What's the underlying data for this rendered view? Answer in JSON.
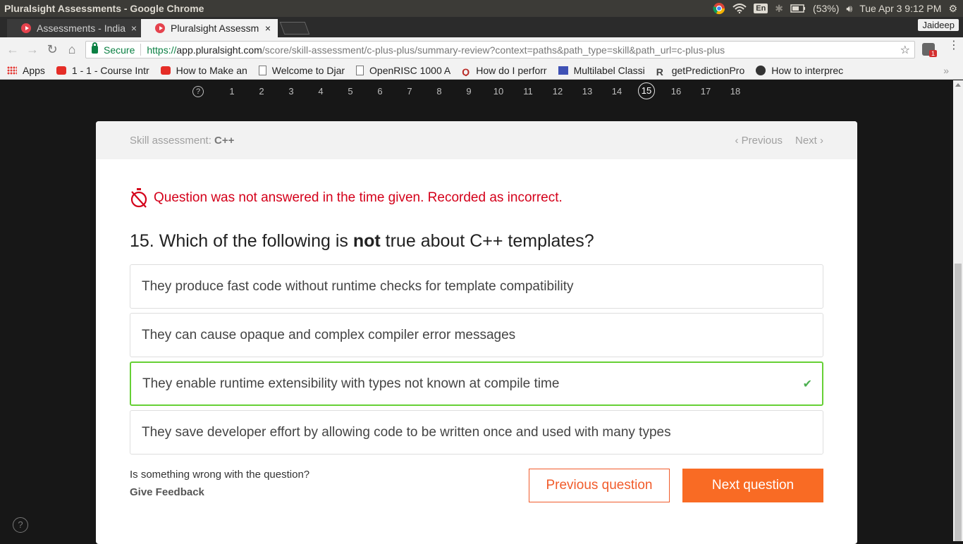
{
  "os": {
    "window_title": "Pluralsight Assessments - Google Chrome",
    "keyboard": "En",
    "battery": "(53%)",
    "clock": "Tue Apr  3  9:12 PM"
  },
  "tabs": [
    {
      "label": "Assessments - India",
      "close": "×"
    },
    {
      "label": "Pluralsight Assessm",
      "close": "×"
    }
  ],
  "profile": "Jaideep",
  "toolbar": {
    "secure_label": "Secure",
    "url_scheme": "https://",
    "url_host": "app.pluralsight.com",
    "url_path": "/score/skill-assessment/c-plus-plus/summary-review?context=paths&path_type=skill&path_url=c-plus-plus",
    "ext_badge": "1"
  },
  "bookmarks": [
    {
      "label": "Apps",
      "icon": "apps-grid-icon"
    },
    {
      "label": "1 - 1 - Course Intr",
      "icon": "youtube-icon"
    },
    {
      "label": "How to Make an",
      "icon": "youtube-icon"
    },
    {
      "label": "Welcome to Djar",
      "icon": "page-icon"
    },
    {
      "label": "OpenRISC 1000 A",
      "icon": "page-icon"
    },
    {
      "label": "How do I perforr",
      "icon": "quora-icon"
    },
    {
      "label": "Multilabel Classi",
      "icon": "ml-icon"
    },
    {
      "label": "getPredictionPro",
      "icon": "r-icon"
    },
    {
      "label": "How to interprec",
      "icon": "github-icon"
    }
  ],
  "question_nav": {
    "numbers": [
      "1",
      "2",
      "3",
      "4",
      "5",
      "6",
      "7",
      "8",
      "9",
      "10",
      "11",
      "12",
      "13",
      "14",
      "15",
      "16",
      "17",
      "18"
    ],
    "current": "15",
    "help": "?"
  },
  "card": {
    "skill_prefix": "Skill assessment: ",
    "skill_name": "C++",
    "previous": "Previous",
    "next": "Next",
    "warning": "Question was not answered in the time given. Recorded as incorrect.",
    "question_number": "15.",
    "question_pre": "Which of the following is ",
    "question_bold": "not",
    "question_post": " true about C++ templates?",
    "answers": [
      {
        "text": "They produce fast code without runtime checks for template compatibility",
        "correct": false
      },
      {
        "text": "They can cause opaque and complex compiler error messages",
        "correct": false
      },
      {
        "text": "They enable runtime extensibility with types not known at compile time",
        "correct": true
      },
      {
        "text": "They save developer effort by allowing code to be written once and used with many types",
        "correct": false
      }
    ],
    "feedback_question": "Is something wrong with the question?",
    "feedback_link": "Give Feedback",
    "prev_button": "Previous question",
    "next_button": "Next question"
  },
  "colors": {
    "accent_orange": "#f96b24",
    "error_red": "#d4001a",
    "correct_green": "#66d035"
  }
}
